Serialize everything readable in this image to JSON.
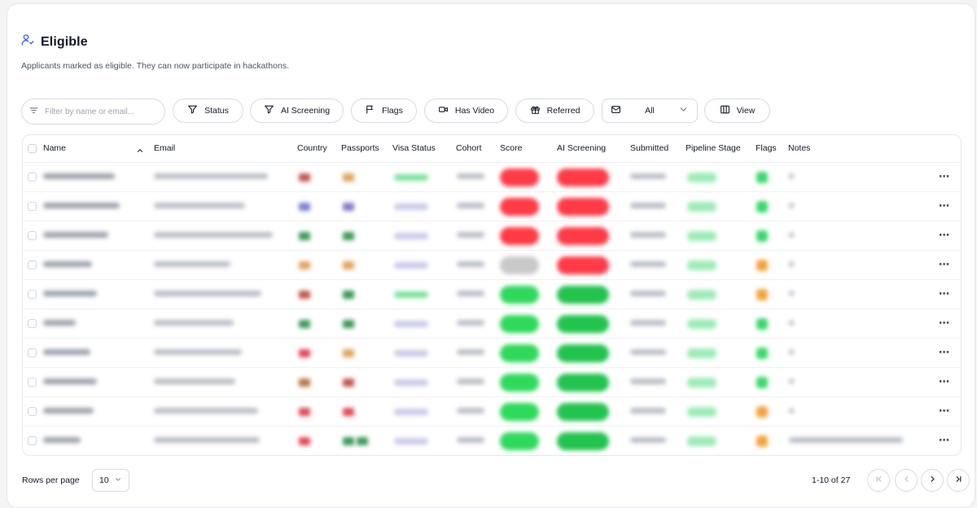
{
  "header": {
    "title": "Eligible",
    "subtitle": "Applicants marked as eligible. They can now participate in hackathons."
  },
  "toolbar": {
    "search_placeholder": "Filter by name or email...",
    "status_label": "Status",
    "ai_screening_label": "AI Screening",
    "flags_label": "Flags",
    "has_video_label": "Has Video",
    "referred_label": "Referred",
    "type_select_value": "All",
    "view_label": "View"
  },
  "table": {
    "columns": [
      "Name",
      "Email",
      "Country",
      "Passports",
      "Visa Status",
      "Cohort",
      "Score",
      "AI Screening",
      "Submitted",
      "Pipeline Stage",
      "Flags",
      "Notes"
    ],
    "row_count_visible": 10,
    "rows": [
      {
        "score_color": "#ff3b47",
        "ai_color": "#ff3b47",
        "flag_color": "#3ad86a",
        "visa_color": "#79e39a",
        "country_color": "#c2574a",
        "passport_color": "#e2a35a"
      },
      {
        "score_color": "#ff3b47",
        "ai_color": "#ff3b47",
        "flag_color": "#3ad86a",
        "visa_color": "#c7cbe8",
        "country_color": "#7b7fd6",
        "passport_color": "#8a78c9"
      },
      {
        "score_color": "#ff3b47",
        "ai_color": "#ff3b47",
        "flag_color": "#3ad86a",
        "visa_color": "#c7cbe8",
        "country_color": "#3a9a54",
        "passport_color": "#3a9a54"
      },
      {
        "score_color": "#c9c9c9",
        "ai_color": "#ff3b47",
        "flag_color": "#f4a33c",
        "visa_color": "#c7cbe8",
        "country_color": "#e3a35c",
        "passport_color": "#e3a35c"
      },
      {
        "score_color": "#2fd95c",
        "ai_color": "#22c44e",
        "flag_color": "#f4a33c",
        "visa_color": "#79e39a",
        "country_color": "#c2574a",
        "passport_color": "#3a9a54"
      },
      {
        "score_color": "#2fd95c",
        "ai_color": "#22c44e",
        "flag_color": "#3ad86a",
        "visa_color": "#c7cbe8",
        "country_color": "#3a9a54",
        "passport_color": "#3a9a54"
      },
      {
        "score_color": "#2fd95c",
        "ai_color": "#22c44e",
        "flag_color": "#3ad86a",
        "visa_color": "#c7cbe8",
        "country_color": "#e24a55",
        "passport_color": "#e3a35c"
      },
      {
        "score_color": "#2fd95c",
        "ai_color": "#22c44e",
        "flag_color": "#3ad86a",
        "visa_color": "#c7cbe8",
        "country_color": "#b9774a",
        "passport_color": "#c2574a"
      },
      {
        "score_color": "#2fd95c",
        "ai_color": "#22c44e",
        "flag_color": "#f4a33c",
        "visa_color": "#c7cbe8",
        "country_color": "#e24a55",
        "passport_color": "#e24a55"
      },
      {
        "score_color": "#2fd95c",
        "ai_color": "#22c44e",
        "flag_color": "#f4a33c",
        "visa_color": "#c7cbe8",
        "country_color": "#e24a55",
        "passport_color": "#3a9a54"
      }
    ]
  },
  "footer": {
    "rows_per_page_label": "Rows per page",
    "rows_per_page_value": "10",
    "range_text": "1-10 of 27"
  },
  "colors": {
    "accent": "#3b5bdb",
    "border": "#d7dae0",
    "positive": "#2fd95c",
    "negative": "#ff3b47",
    "warning": "#f4a33c"
  }
}
